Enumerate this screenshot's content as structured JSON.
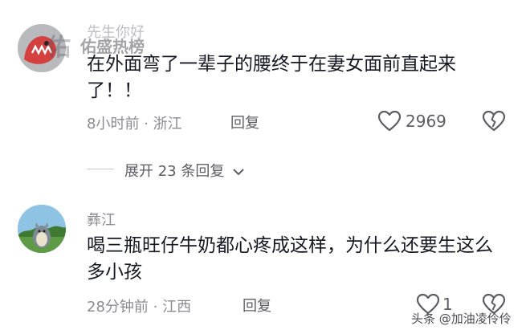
{
  "watermark": {
    "brand": "佑盛热榜"
  },
  "comments": [
    {
      "username": "先生你好",
      "text": "在外面弯了一辈子的腰终于在妻女面前直起来了！！",
      "time": "8小时前",
      "separator": "·",
      "location": "浙江",
      "reply_label": "回复",
      "likes": "2969"
    },
    {
      "username": "彝江",
      "text": "喝三瓶旺仔牛奶都心疼成这样，为什么还要生这么多小孩",
      "time": "28分钟前",
      "separator": "·",
      "location": "江西",
      "reply_label": "回复",
      "likes": "1"
    }
  ],
  "expand": {
    "label": "展开 23 条回复"
  },
  "source_watermark": {
    "text": "头条 @加油凌伶伶"
  },
  "colors": {
    "accent_red": "#e84b4e",
    "meta_gray": "#8a8b91",
    "text": "#161823"
  }
}
